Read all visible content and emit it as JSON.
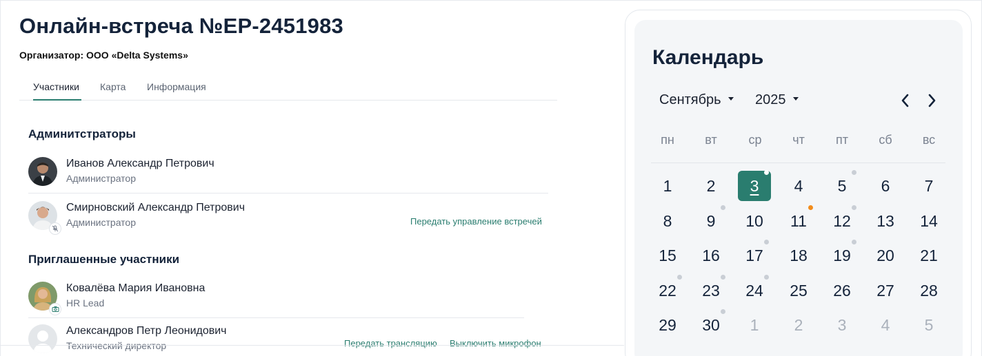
{
  "header": {
    "title": "Онлайн-встреча №EP-2451983",
    "organizer": "Организатор: ООО «Delta Systems»"
  },
  "tabs": [
    {
      "label": "Участники",
      "active": true
    },
    {
      "label": "Карта",
      "active": false
    },
    {
      "label": "Информация",
      "active": false
    }
  ],
  "admins": {
    "heading": "Админитстраторы",
    "people": [
      {
        "name": "Иванов Александр Петрович",
        "role": "Администратор"
      },
      {
        "name": "Смирновский Александр Петрович",
        "role": "Администратор",
        "badge_icon": "mic-off-icon",
        "action": "Передать управление встречей"
      }
    ]
  },
  "invited": {
    "heading": "Приглашенные участники",
    "people": [
      {
        "name": "Ковалёва Мария Ивановна",
        "role": "HR Lead",
        "badge_icon": "camera-icon"
      },
      {
        "name": "Александров Петр Леонидович",
        "role": "Технический директор",
        "actions": [
          "Передать трансляцию",
          "Выключить микрофон"
        ]
      }
    ]
  },
  "calendar": {
    "title": "Календарь",
    "month": "Сентябрь",
    "year": "2025",
    "weekdays": [
      "пн",
      "вт",
      "ср",
      "чт",
      "пт",
      "сб",
      "вс"
    ],
    "accent_color": "#2a7d6f",
    "dot_colors": {
      "gray": "#c9ced5",
      "orange": "#f28c1c",
      "white": "#ffffff"
    },
    "weeks": [
      [
        {
          "d": "1"
        },
        {
          "d": "2"
        },
        {
          "d": "3",
          "today": true,
          "dot": "white"
        },
        {
          "d": "4"
        },
        {
          "d": "5",
          "dot": "gray"
        },
        {
          "d": "6"
        },
        {
          "d": "7"
        }
      ],
      [
        {
          "d": "8"
        },
        {
          "d": "9",
          "dot": "gray"
        },
        {
          "d": "10"
        },
        {
          "d": "11",
          "dot": "orange"
        },
        {
          "d": "12",
          "dot": "gray"
        },
        {
          "d": "13"
        },
        {
          "d": "14"
        }
      ],
      [
        {
          "d": "15"
        },
        {
          "d": "16"
        },
        {
          "d": "17",
          "dot": "gray"
        },
        {
          "d": "18"
        },
        {
          "d": "19",
          "dot": "gray"
        },
        {
          "d": "20"
        },
        {
          "d": "21"
        }
      ],
      [
        {
          "d": "22",
          "dot": "gray"
        },
        {
          "d": "23",
          "dot": "gray"
        },
        {
          "d": "24",
          "dot": "gray"
        },
        {
          "d": "25"
        },
        {
          "d": "26"
        },
        {
          "d": "27"
        },
        {
          "d": "28"
        }
      ],
      [
        {
          "d": "29"
        },
        {
          "d": "30",
          "dot": "gray"
        },
        {
          "d": "1",
          "muted": true
        },
        {
          "d": "2",
          "muted": true
        },
        {
          "d": "3",
          "muted": true
        },
        {
          "d": "4",
          "muted": true
        },
        {
          "d": "5",
          "muted": true
        }
      ]
    ]
  }
}
